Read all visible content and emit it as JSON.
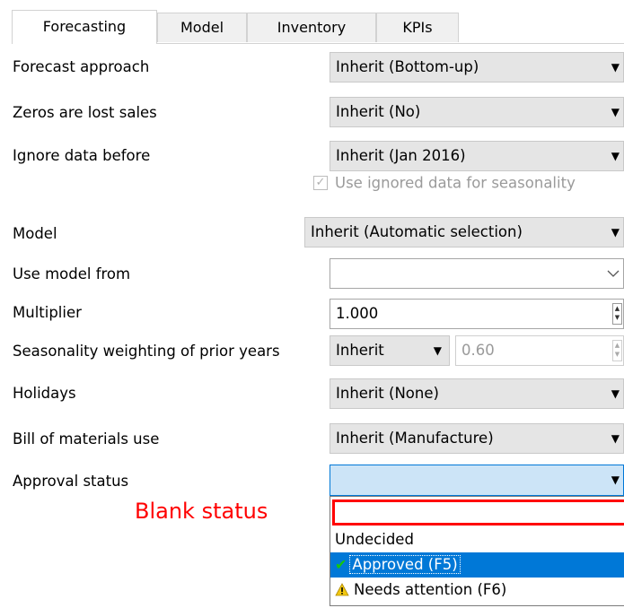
{
  "tabs": [
    "Forecasting",
    "Model",
    "Inventory",
    "KPIs"
  ],
  "fields": {
    "forecast_approach": {
      "label": "Forecast approach",
      "value": "Inherit (Bottom-up)"
    },
    "zeros_lost_sales": {
      "label": "Zeros are lost sales",
      "value": "Inherit (No)"
    },
    "ignore_data_before": {
      "label": "Ignore data before",
      "value": "Inherit (Jan 2016)"
    },
    "use_ignored_seasonality": {
      "label": "Use ignored data for seasonality",
      "checked": true
    },
    "model": {
      "label": "Model",
      "value": "Inherit (Automatic selection)"
    },
    "use_model_from": {
      "label": "Use model from",
      "value": ""
    },
    "multiplier": {
      "label": "Multiplier",
      "value": "1.000"
    },
    "seasonality_weighting": {
      "label": "Seasonality weighting of prior years",
      "value": "Inherit",
      "number": "0.60"
    },
    "holidays": {
      "label": "Holidays",
      "value": "Inherit (None)"
    },
    "bom_use": {
      "label": "Bill of materials use",
      "value": "Inherit (Manufacture)"
    },
    "approval_status": {
      "label": "Approval status",
      "value": ""
    }
  },
  "annotation": "Blank status",
  "dropdown_options": [
    {
      "label": "",
      "icon": "none"
    },
    {
      "label": "Undecided",
      "icon": "none"
    },
    {
      "label": "Approved (F5)",
      "icon": "check-icon",
      "selected": true
    },
    {
      "label": "Needs attention (F6)",
      "icon": "warning-icon"
    }
  ],
  "colors": {
    "annotation": "#ff0000",
    "selection": "#0078d7",
    "approval_combo": "#cce4f7",
    "check": "#16c60c",
    "warning": "#f2c811"
  }
}
